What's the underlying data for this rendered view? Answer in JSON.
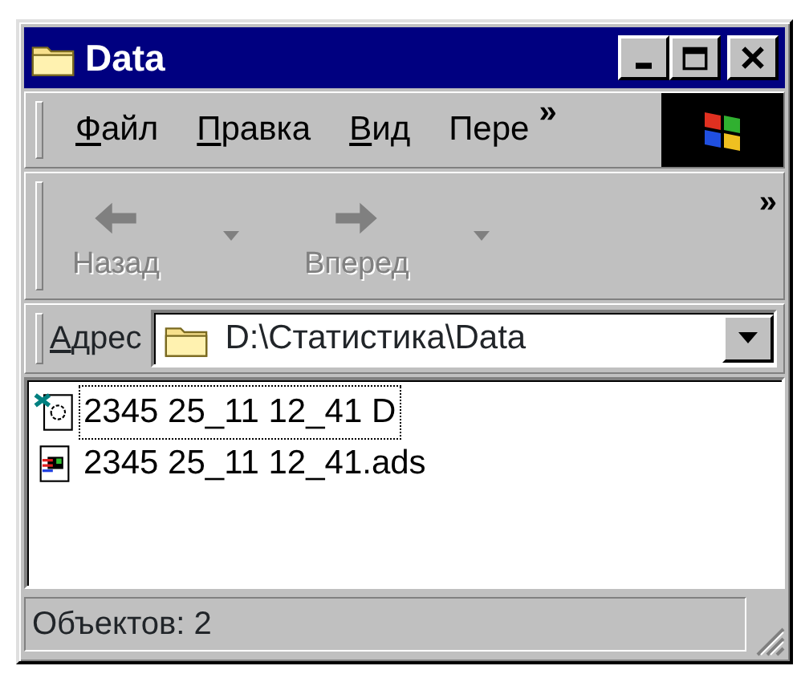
{
  "window": {
    "title": "Data",
    "buttons": [
      {
        "kind": "minimize"
      },
      {
        "kind": "maximize"
      },
      {
        "kind": "close"
      }
    ]
  },
  "menu_bar": {
    "items": [
      {
        "label": "Файл",
        "first_letter_underlined": true
      },
      {
        "label": "Правка",
        "first_letter_underlined": true
      },
      {
        "label": "Вид",
        "first_letter_underlined": true
      },
      {
        "label": "Пере",
        "first_letter_underlined": false
      }
    ],
    "chevron": "»"
  },
  "toolbar": {
    "buttons": [
      {
        "kind": "back",
        "label": "Назад",
        "disabled": true
      },
      {
        "kind": "forward",
        "label": "Вперед",
        "disabled": true
      }
    ],
    "chevron": "»"
  },
  "address_bar": {
    "label": "Адрес",
    "first_letter_underlined": true,
    "value": "D:\\Статистика\\Data"
  },
  "files": [
    {
      "kind": "shortcut",
      "name": "2345 25_11 12_41 D",
      "focused": true
    },
    {
      "kind": "document",
      "name": "2345 25_11 12_41.ads",
      "focused": false
    }
  ],
  "status_bar": {
    "text": "Объектов: 2"
  }
}
